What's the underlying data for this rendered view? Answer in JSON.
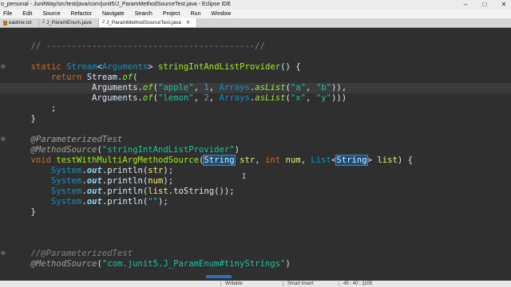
{
  "window": {
    "title": "o_personal - JunitWay/src/test/java/com/junit5/J_ParamMethodSourceTest.java - Eclipse IDE",
    "min": "–",
    "max": "□",
    "close": "✕"
  },
  "menu": [
    "File",
    "Edit",
    "Source",
    "Refactor",
    "Navigate",
    "Search",
    "Project",
    "Run",
    "Window"
  ],
  "tabs": [
    {
      "label": "eadme.txt",
      "active": false
    },
    {
      "label": "J_ParamEnum.java",
      "active": false
    },
    {
      "label": "J_ParamMethodSourceTest.java",
      "active": true
    }
  ],
  "tab_close": "✕",
  "code_lines": [
    {
      "gutter": "",
      "text": "    // -----------------------------------------//"
    },
    {
      "gutter": "",
      "text": ""
    },
    {
      "gutter": "⊖",
      "text": "    static Stream<Arguments> stringIntAndListProvider() {"
    },
    {
      "gutter": "",
      "text": "        return Stream.of("
    },
    {
      "gutter": "",
      "text": "                Arguments.of(\"apple\", 1, Arrays.asList(\"a\", \"b\")),"
    },
    {
      "gutter": "",
      "text": "                Arguments.of(\"lemon\", 2, Arrays.asList(\"x\", \"y\")))"
    },
    {
      "gutter": "",
      "text": "        ;"
    },
    {
      "gutter": "",
      "text": "    }"
    },
    {
      "gutter": "",
      "text": ""
    },
    {
      "gutter": "⊖",
      "text": "    @ParameterizedTest"
    },
    {
      "gutter": "",
      "text": "    @MethodSource(\"stringIntAndListProvider\")"
    },
    {
      "gutter": "",
      "text": "    void testWithMultiArgMethodSource(String str, int num, List<String> list) {"
    },
    {
      "gutter": "",
      "text": "        System.out.println(str);"
    },
    {
      "gutter": "",
      "text": "        System.out.println(num);"
    },
    {
      "gutter": "",
      "text": "        System.out.println(list.toString());"
    },
    {
      "gutter": "",
      "text": "        System.out.println(\"\");"
    },
    {
      "gutter": "",
      "text": "    }"
    },
    {
      "gutter": "",
      "text": ""
    },
    {
      "gutter": "",
      "text": ""
    },
    {
      "gutter": "",
      "text": ""
    },
    {
      "gutter": "⊖",
      "text": "    //@ParameterizedTest"
    },
    {
      "gutter": "",
      "text": "    @MethodSource(\"com.junit5.J_ParamEnum#tinyStrings\")"
    }
  ],
  "status": {
    "writable": "Writable",
    "insert_mode": "Smart Insert",
    "position": "45 : 40 : 1105"
  },
  "colors": {
    "editor_bg": "#2f2f2f",
    "keyword": "#cc6c1d",
    "type": "#1290c3",
    "string": "#17c6a3",
    "method": "#a7ec21",
    "selection": "#1d4f78"
  }
}
